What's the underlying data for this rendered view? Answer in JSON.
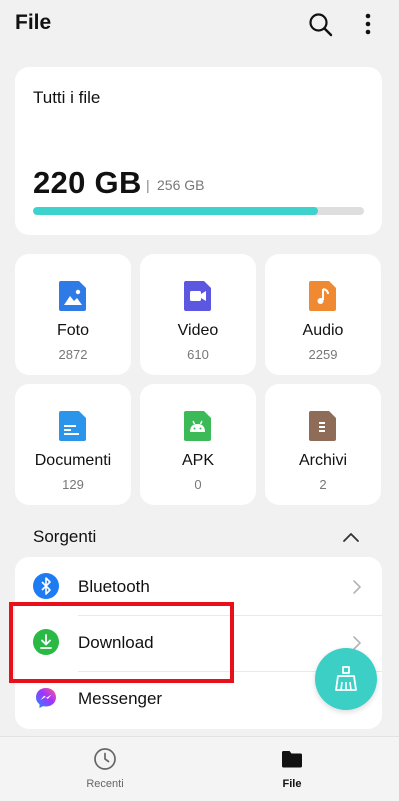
{
  "header": {
    "title": "File"
  },
  "storage": {
    "title": "Tutti i file",
    "used": "220 GB",
    "separator": "|",
    "total": "256 GB",
    "used_fraction": 0.86
  },
  "categories": [
    {
      "label": "Foto",
      "count": "2872",
      "icon": "image-icon",
      "color": "#2e7be8"
    },
    {
      "label": "Video",
      "count": "610",
      "icon": "video-icon",
      "color": "#5b57e0"
    },
    {
      "label": "Audio",
      "count": "2259",
      "icon": "music-icon",
      "color": "#ef8a33"
    },
    {
      "label": "Documenti",
      "count": "129",
      "icon": "document-icon",
      "color": "#2b95ec"
    },
    {
      "label": "APK",
      "count": "0",
      "icon": "android-icon",
      "color": "#3cba58"
    },
    {
      "label": "Archivi",
      "count": "2",
      "icon": "archive-icon",
      "color": "#8e6c58"
    }
  ],
  "sources": {
    "title": "Sorgenti",
    "items": [
      {
        "label": "Bluetooth",
        "icon": "bluetooth-icon",
        "color": "#1d7cf2"
      },
      {
        "label": "Download",
        "icon": "download-icon",
        "color": "#29b944"
      },
      {
        "label": "Messenger",
        "icon": "messenger-icon",
        "color": "#8a4dfb"
      }
    ]
  },
  "bottom_nav": {
    "items": [
      {
        "label": "Recenti",
        "icon": "clock-icon",
        "active": false
      },
      {
        "label": "File",
        "icon": "folder-icon",
        "active": true
      }
    ]
  },
  "colors": {
    "accent": "#3ed2cc",
    "highlight": "#e8101b",
    "background": "#f1f1f1"
  }
}
